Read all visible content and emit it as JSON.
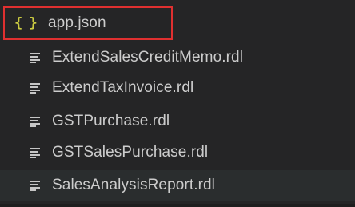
{
  "explorer": {
    "files": [
      {
        "name": "app.json",
        "icon": "json-braces-icon",
        "icon_glyph": "{ }",
        "icon_color": "#cbcb41"
      },
      {
        "name": "ExtendSalesCreditMemo.rdl",
        "icon": "text-lines-icon"
      },
      {
        "name": "ExtendTaxInvoice.rdl",
        "icon": "text-lines-icon"
      },
      {
        "name": "GSTPurchase.rdl",
        "icon": "text-lines-icon"
      },
      {
        "name": "GSTSalesPurchase.rdl",
        "icon": "text-lines-icon"
      },
      {
        "name": "SalesAnalysisReport.rdl",
        "icon": "text-lines-icon"
      }
    ],
    "highlight_color": "#e03030",
    "background_color": "#252526",
    "text_color": "#cccccc"
  }
}
